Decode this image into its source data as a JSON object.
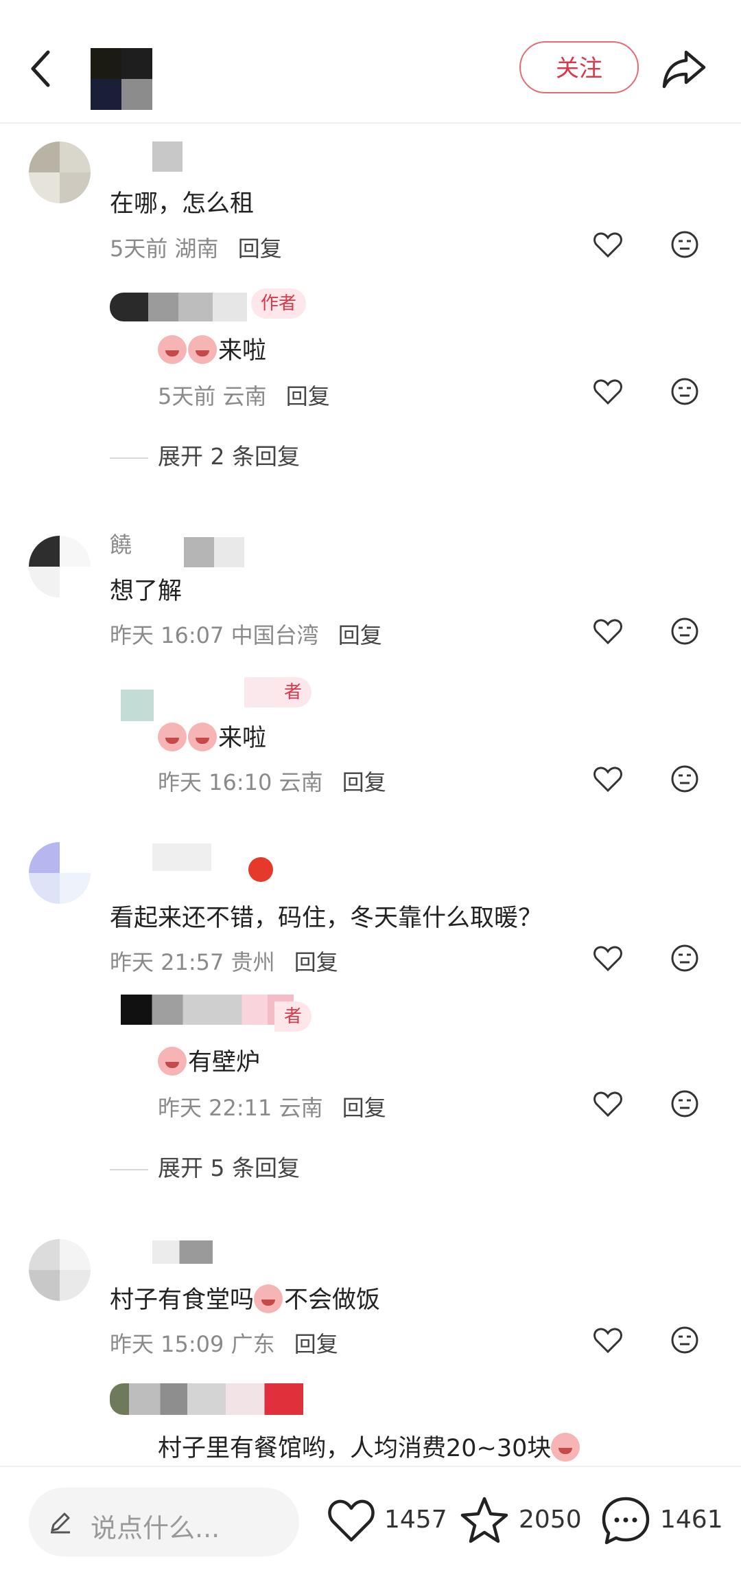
{
  "header": {
    "follow_label": "关注",
    "icons": {
      "back": "chevron-left-icon",
      "share": "share-arrow-icon"
    }
  },
  "comments": [
    {
      "text": "在哪，怎么租",
      "time": "5天前",
      "region": "湖南",
      "reply_label": "回复",
      "replies": [
        {
          "author_tag": "作者",
          "text": "来啦",
          "time": "5天前",
          "region": "云南",
          "reply_label": "回复"
        }
      ],
      "expand": "展开 2 条回复"
    },
    {
      "name_fragment": "饒",
      "text": "想了解",
      "time": "昨天 16:07",
      "region": "中国台湾",
      "reply_label": "回复",
      "replies": [
        {
          "author_tag": "者",
          "text": "来啦",
          "time": "昨天 16:10",
          "region": "云南",
          "reply_label": "回复"
        }
      ]
    },
    {
      "text": "看起来还不错，码住，冬天靠什么取暖？",
      "time": "昨天 21:57",
      "region": "贵州",
      "reply_label": "回复",
      "replies": [
        {
          "author_tag": "者",
          "text": "有壁炉",
          "time": "昨天 22:11",
          "region": "云南",
          "reply_label": "回复"
        }
      ],
      "expand": "展开 5 条回复"
    },
    {
      "text_a": "村子有食堂吗",
      "text_b": "不会做饭",
      "time": "昨天 15:09",
      "region": "广东",
      "reply_label": "回复",
      "replies": [
        {
          "text": "村子里有餐馆哟，人均消费20~30块"
        }
      ]
    }
  ],
  "bottom_bar": {
    "placeholder": "说点什么...",
    "likes": "1457",
    "stars": "2050",
    "comments": "1461"
  },
  "colors": {
    "accent": "#d8394a",
    "meta": "#8a8a8a"
  }
}
